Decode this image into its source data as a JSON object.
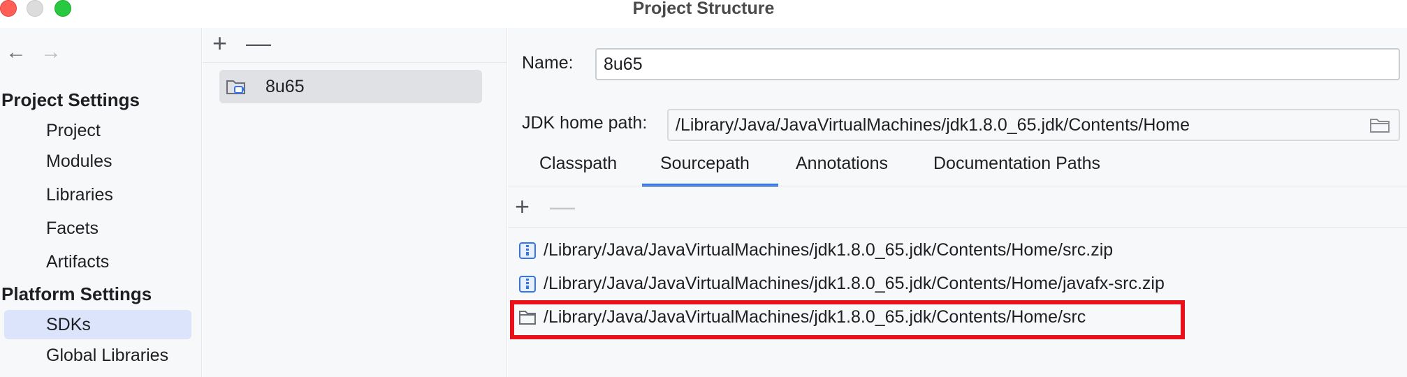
{
  "window": {
    "title": "Project Structure"
  },
  "nav": {
    "back_icon": "arrow-left-icon",
    "forward_icon": "arrow-right-icon",
    "project_settings_header": "Project Settings",
    "project_items": [
      "Project",
      "Modules",
      "Libraries",
      "Facets",
      "Artifacts"
    ],
    "platform_settings_header": "Platform Settings",
    "platform_items": [
      "SDKs",
      "Global Libraries"
    ],
    "selected": "SDKs"
  },
  "sdk_list": {
    "add_icon": "plus-icon",
    "remove_icon": "minus-icon",
    "items": [
      {
        "label": "8u65",
        "icon": "jdk-folder-icon"
      }
    ]
  },
  "details": {
    "name_label": "Name:",
    "name_value": "8u65",
    "jdk_home_label": "JDK home path:",
    "jdk_home_value": "/Library/Java/JavaVirtualMachines/jdk1.8.0_65.jdk/Contents/Home",
    "browse_icon": "folder-icon",
    "tabs": [
      "Classpath",
      "Sourcepath",
      "Annotations",
      "Documentation Paths"
    ],
    "active_tab": "Sourcepath",
    "sourcepath": {
      "add_icon": "plus-icon",
      "remove_icon": "minus-icon",
      "entries": [
        {
          "path": "/Library/Java/JavaVirtualMachines/jdk1.8.0_65.jdk/Contents/Home/src.zip",
          "icon": "archive-icon"
        },
        {
          "path": "/Library/Java/JavaVirtualMachines/jdk1.8.0_65.jdk/Contents/Home/javafx-src.zip",
          "icon": "archive-icon"
        },
        {
          "path": "/Library/Java/JavaVirtualMachines/jdk1.8.0_65.jdk/Contents/Home/src",
          "icon": "folder-icon"
        }
      ]
    }
  },
  "colors": {
    "accent": "#3574f0",
    "highlight_box": "#e8101a",
    "selected_nav": "#dbe4fb"
  }
}
